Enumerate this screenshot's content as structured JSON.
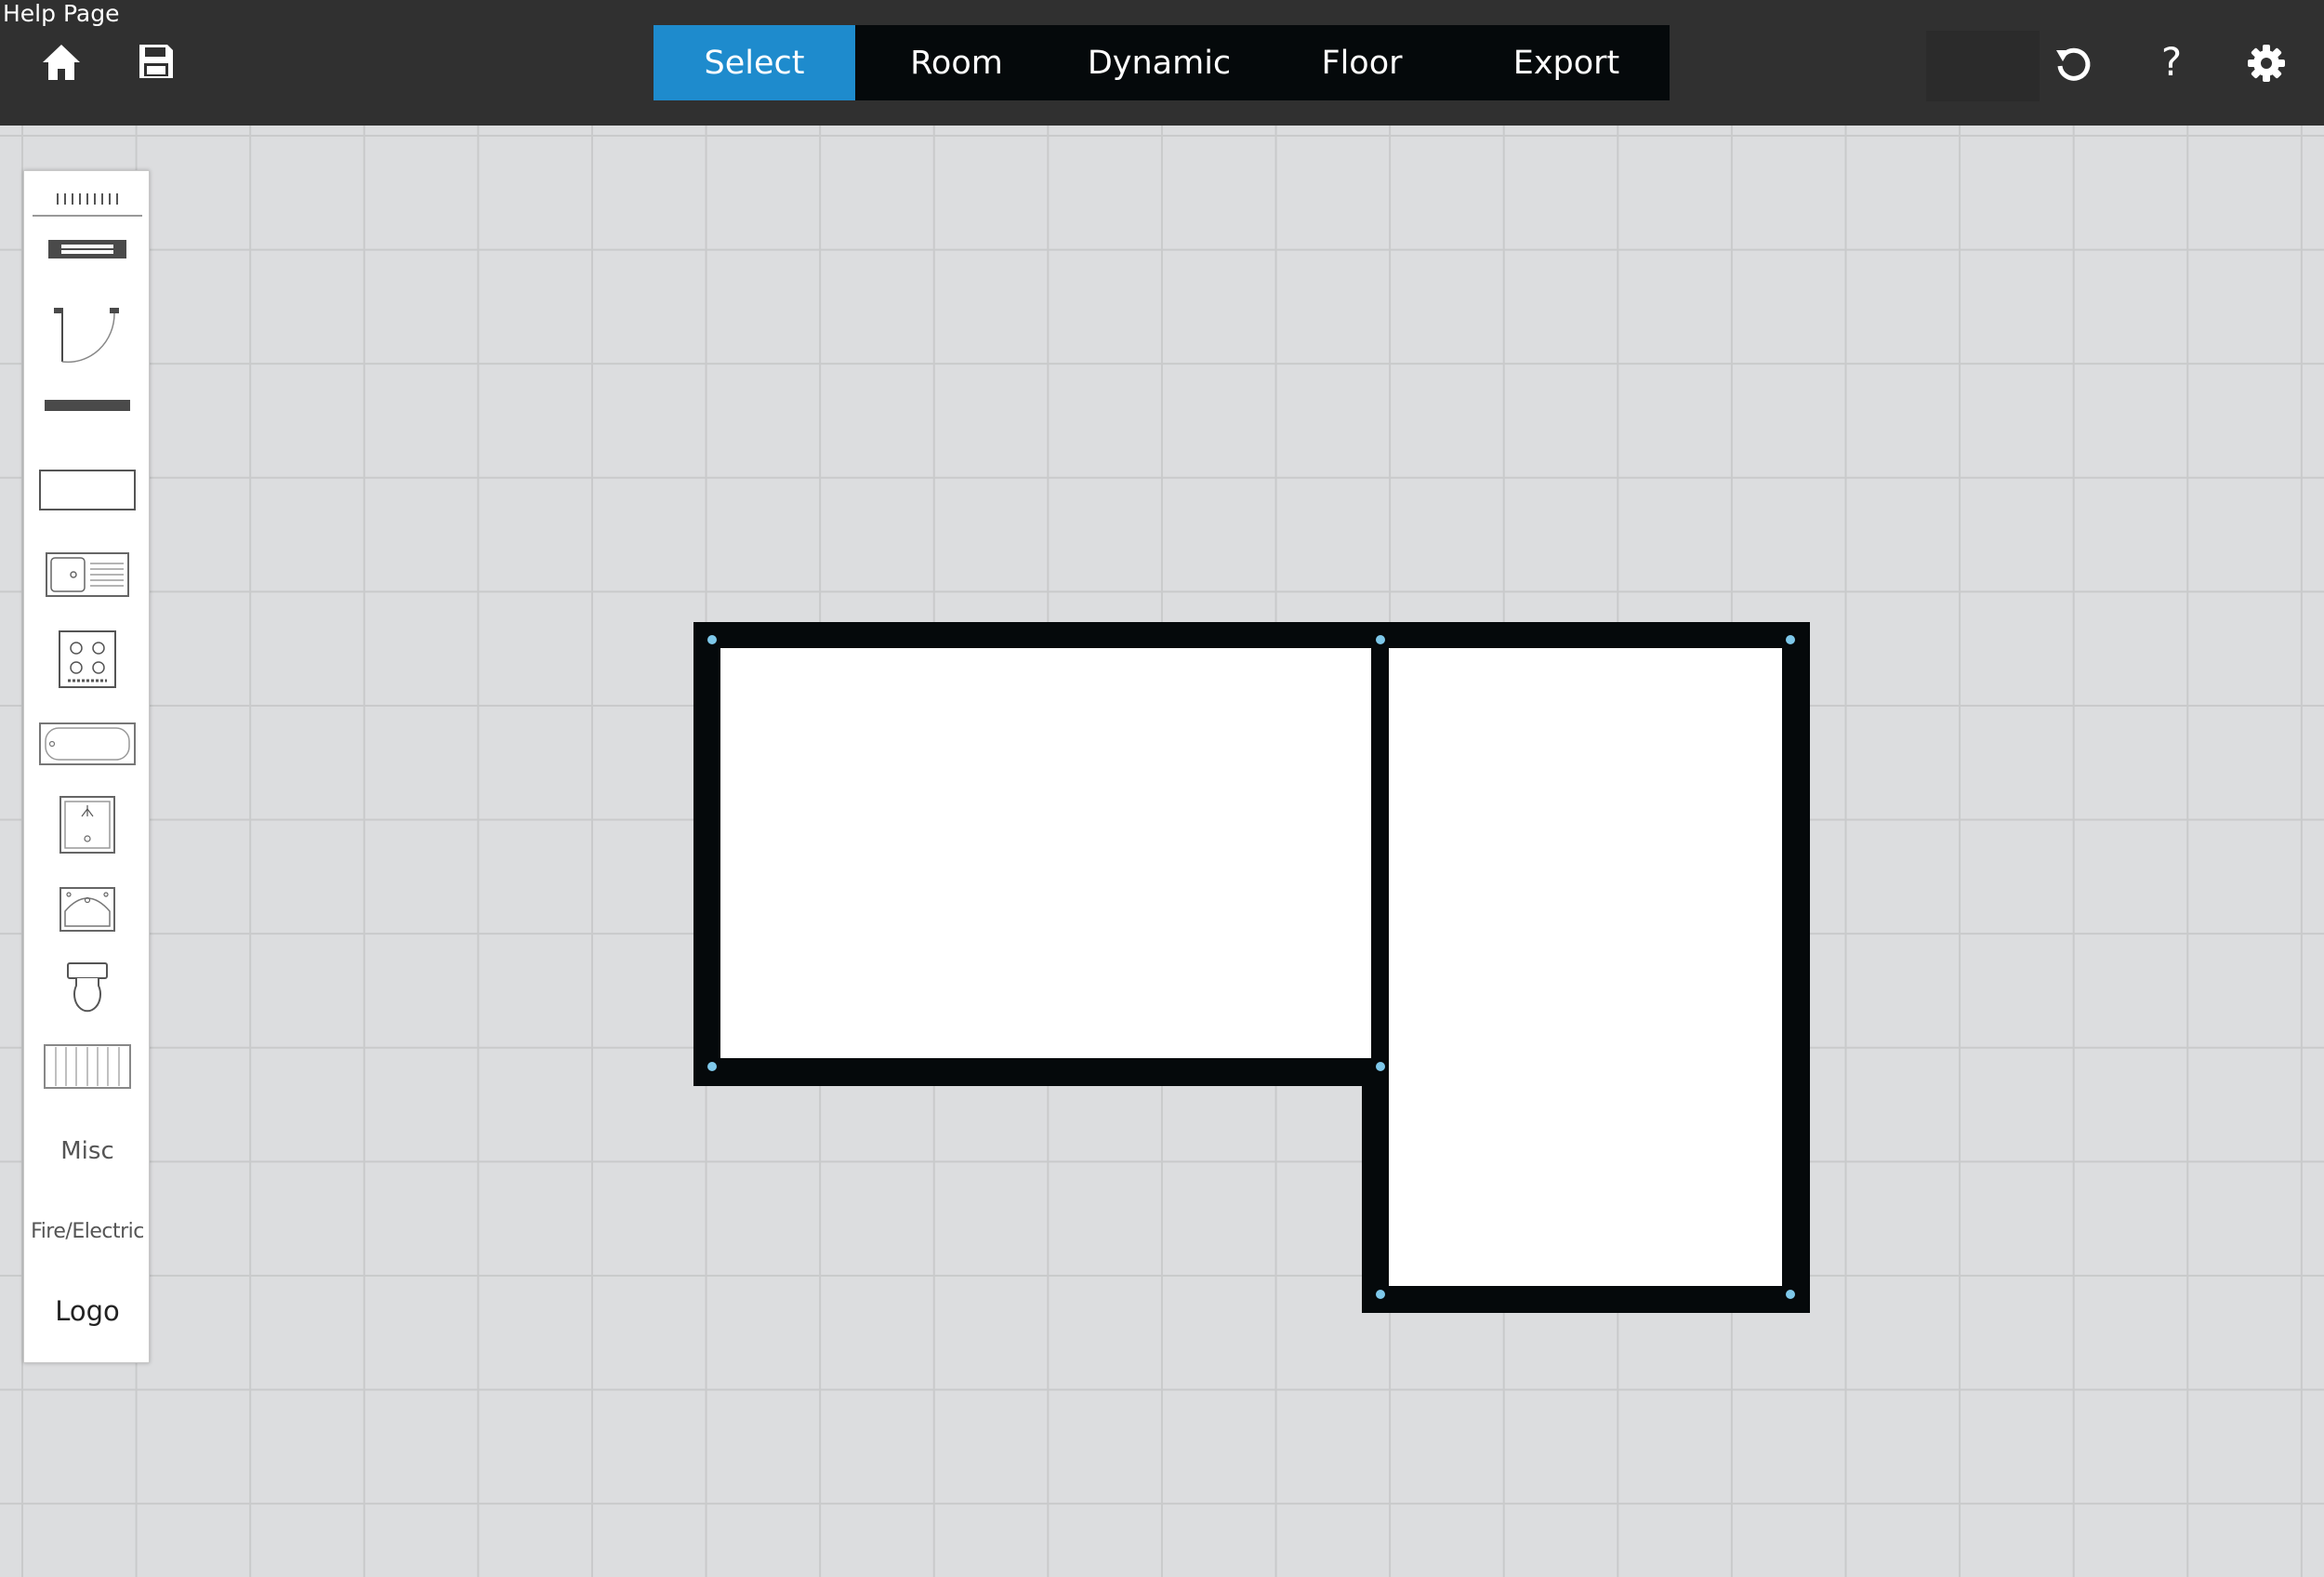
{
  "header": {
    "help_link": "Help Page",
    "left_icons": [
      "home-icon",
      "save-icon"
    ],
    "right_icons": [
      "undo-icon",
      "help-icon",
      "gear-icon"
    ],
    "help_glyph": "?"
  },
  "modes": {
    "active": "Select",
    "tabs": [
      {
        "label": "Select"
      },
      {
        "label": "Room"
      },
      {
        "label": "Dynamic"
      },
      {
        "label": "Floor"
      },
      {
        "label": "Export"
      }
    ]
  },
  "toolbox": {
    "items": [
      {
        "icon": "drag-handle-icon"
      },
      {
        "icon": "window-icon"
      },
      {
        "icon": "door-icon"
      },
      {
        "icon": "wall-segment-icon"
      },
      {
        "icon": "worktop-icon"
      },
      {
        "icon": "sink-drainer-icon"
      },
      {
        "icon": "hob-icon"
      },
      {
        "icon": "bath-icon"
      },
      {
        "icon": "shower-icon"
      },
      {
        "icon": "basin-icon"
      },
      {
        "icon": "toilet-icon"
      },
      {
        "icon": "radiator-icon"
      }
    ],
    "text_items": [
      {
        "label": "Misc"
      },
      {
        "label": "Fire/Electric"
      },
      {
        "label": "Logo"
      }
    ]
  },
  "colors": {
    "topbar": "#303030",
    "tab_active": "#1e8bcd",
    "tab_bar": "#05090b",
    "canvas": "#dcdddf",
    "wall": "#05090b",
    "corner_handle": "#7ec8ea"
  },
  "floor_plan": {
    "rooms": [
      {
        "name": "room-left"
      },
      {
        "name": "room-right"
      }
    ]
  }
}
